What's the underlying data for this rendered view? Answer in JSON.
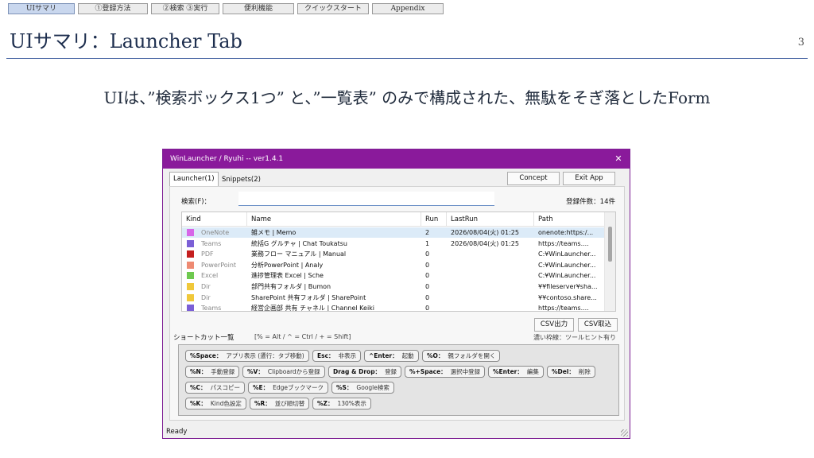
{
  "nav": [
    "UIサマリ",
    "①登録方法",
    "②検索 ③実行",
    "便利機能",
    "クイックスタート",
    "Appendix"
  ],
  "slide": {
    "title": "UIサマリ：Launcher Tab",
    "page_number": "3",
    "subtitle": "UIは、”検索ボックス1つ” と、”一覧表” のみで構成された、無駄をそぎ落としたForm"
  },
  "window": {
    "title": "WinLauncher / Ryuhi -- ver1.4.1",
    "close": "✕",
    "tabs": [
      "Launcher(1)",
      "Snippets(2)"
    ],
    "buttons": {
      "concept": "Concept",
      "exit": "Exit App",
      "csv_export": "CSV出力",
      "csv_import": "CSV取込"
    },
    "search": {
      "label": "検索(F)：",
      "value": "",
      "count": "登録件数：14件"
    },
    "grid": {
      "columns": [
        "Kind",
        "Name",
        "Run",
        "LastRun",
        "Path"
      ],
      "rows": [
        {
          "kind": "OneNote",
          "color": "#d766e8",
          "name": "雑メモ | Memo",
          "run": "2",
          "last_run": "2026/08/04(火) 01:25",
          "path": "onenote:https:/...",
          "selected": true
        },
        {
          "kind": "Teams",
          "color": "#7b5fd6",
          "name": "統括G グルチャ | Chat Toukatsu",
          "run": "1",
          "last_run": "2026/08/04(火) 01:25",
          "path": "https://teams...."
        },
        {
          "kind": "PDF",
          "color": "#c41f1f",
          "name": "業務フロー マニュアル | Manual",
          "run": "0",
          "last_run": "",
          "path": "C:¥WinLauncher..."
        },
        {
          "kind": "PowerPoint",
          "color": "#ee8a72",
          "name": "分析PowerPoint | Analy",
          "run": "0",
          "last_run": "",
          "path": "C:¥WinLauncher..."
        },
        {
          "kind": "Excel",
          "color": "#6ec94f",
          "name": "進捗管理表 Excel | Sche",
          "run": "0",
          "last_run": "",
          "path": "C:¥WinLauncher..."
        },
        {
          "kind": "Dir",
          "color": "#f0c83a",
          "name": "部門共有フォルダ | Bumon",
          "run": "0",
          "last_run": "",
          "path": "¥¥fileserver¥sha..."
        },
        {
          "kind": "Dir",
          "color": "#f0c83a",
          "name": "SharePoint 共有フォルダ | SharePoint",
          "run": "0",
          "last_run": "",
          "path": "¥¥contoso.share..."
        },
        {
          "kind": "Teams",
          "color": "#7b5fd6",
          "name": "経営企画部 共有 チャネル | Channel Keiki",
          "run": "0",
          "last_run": "",
          "path": "https://teams...."
        }
      ]
    },
    "shortcuts": {
      "title": "ショートカット一覧",
      "legend": "[% = Alt / ^ = Ctrl / + = Shift]",
      "hint": "濃い枠線：ツールヒント有り",
      "rows": [
        [
          {
            "key": "%Space：",
            "desc": "アプリ表示 (遷行：タブ移動)"
          },
          {
            "key": "Esc：",
            "desc": "非表示"
          },
          {
            "key": "^Enter：",
            "desc": "起動"
          },
          {
            "key": "%O：",
            "desc": "親フォルダを開く"
          }
        ],
        [
          {
            "key": "%N：",
            "desc": "手動登録"
          },
          {
            "key": "%V：",
            "desc": "Clipboardから登録"
          },
          {
            "key": "Drag & Drop：",
            "desc": "登録"
          },
          {
            "key": "%+Space：",
            "desc": "選択中登録"
          },
          {
            "key": "%Enter：",
            "desc": "編集"
          },
          {
            "key": "%Del：",
            "desc": "削除"
          }
        ],
        [
          {
            "key": "%C：",
            "desc": "パスコピー"
          },
          {
            "key": "%E：",
            "desc": "Edgeブックマーク"
          },
          {
            "key": "%S：",
            "desc": "Google検索"
          }
        ],
        [
          {
            "key": "%K：",
            "desc": "Kind色設定"
          },
          {
            "key": "%R：",
            "desc": "並び順切替"
          },
          {
            "key": "%Z：",
            "desc": "130%表示"
          }
        ]
      ]
    },
    "status": "Ready"
  }
}
